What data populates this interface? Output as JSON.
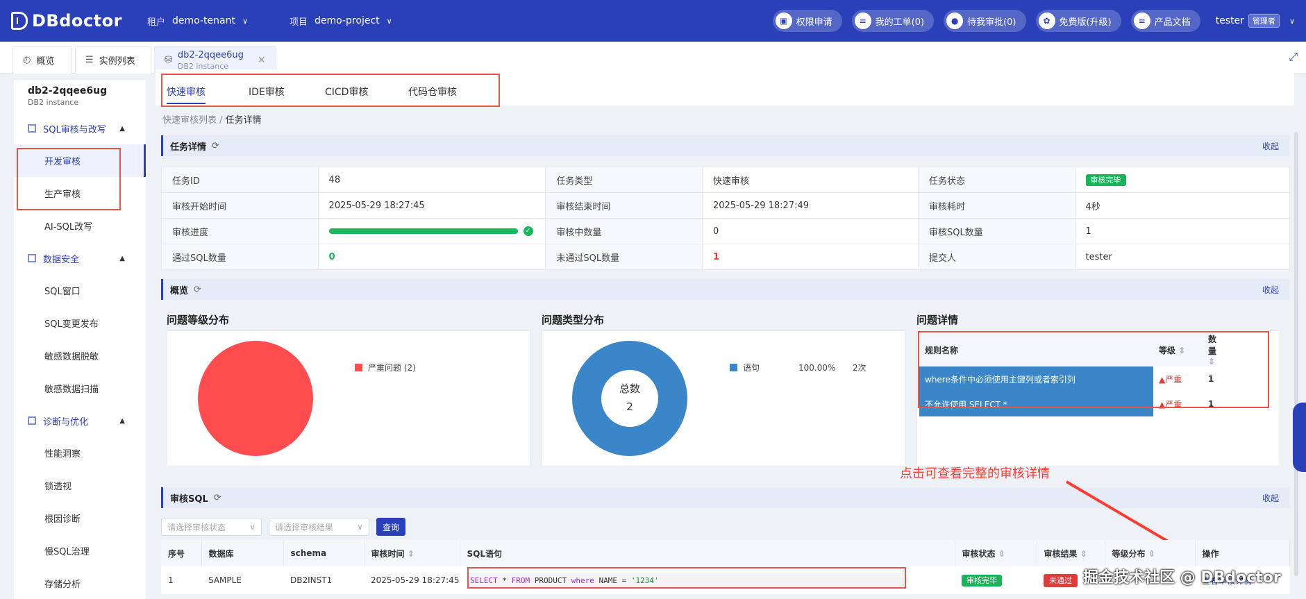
{
  "app": {
    "logo": "DBdoctor",
    "tenant_label": "租户",
    "tenant_value": "demo-tenant",
    "project_label": "项目",
    "project_value": "demo-project",
    "actions": [
      "权限申请",
      "我的工单(0)",
      "待我审批(0)",
      "免费版(升级)",
      "产品文档"
    ],
    "user": "tester",
    "role": "管理者"
  },
  "tabs": {
    "overview": "概览",
    "instances": "实例列表",
    "active_name": "db2-2qqee6ug",
    "active_sub": "DB2 instance"
  },
  "sidebar": {
    "inst_name": "db2-2qqee6ug",
    "inst_type": "DB2 instance",
    "groups": [
      {
        "label": "SQL审核与改写",
        "items": [
          "开发审核",
          "生产审核",
          "AI-SQL改写"
        ]
      },
      {
        "label": "数据安全",
        "items": [
          "SQL窗口",
          "SQL变更发布",
          "敏感数据脱敏",
          "敏感数据扫描"
        ]
      },
      {
        "label": "诊断与优化",
        "items": [
          "性能洞察",
          "锁透视",
          "根因诊断",
          "慢SQL治理",
          "存储分析"
        ]
      }
    ]
  },
  "subtabs": [
    "快速审核",
    "IDE审核",
    "CICD审核",
    "代码仓审核"
  ],
  "breadcrumb": {
    "parent": "快速审核列表",
    "current": "任务详情"
  },
  "sections": {
    "task": "任务详情",
    "overview": "概览",
    "sql": "审核SQL",
    "fold": "收起"
  },
  "task": {
    "id_l": "任务ID",
    "id": "48",
    "type_l": "任务类型",
    "type": "快速审核",
    "status_l": "任务状态",
    "status": "审核完毕",
    "start_l": "审核开始时间",
    "start": "2025-05-29 18:27:45",
    "end_l": "审核结束时间",
    "end": "2025-05-29 18:27:49",
    "cost_l": "审核耗时",
    "cost": "4秒",
    "progress_l": "审核进度",
    "progress": 1.0,
    "auditing_l": "审核中数量",
    "auditing": "0",
    "sqlcount_l": "审核SQL数量",
    "sqlcount": "1",
    "pass_l": "通过SQL数量",
    "pass": "0",
    "fail_l": "未通过SQL数量",
    "fail": "1",
    "submitter_l": "提交人",
    "submitter": "tester"
  },
  "overview": {
    "level_title": "问题等级分布",
    "type_title": "问题类型分布",
    "detail_title": "问题详情",
    "level_legend": "严重问题 (2)",
    "type_legend": "语句",
    "type_pct": "100.00%",
    "type_cnt": "2次",
    "donut_label": "总数",
    "donut_value": "2",
    "cols": {
      "name": "规则名称",
      "level": "等级",
      "count": "数量"
    },
    "issues": [
      {
        "name": "where条件中必须使用主键列或者索引列",
        "level": "严重",
        "count": "1"
      },
      {
        "name": "不允许使用 SELECT *",
        "level": "严重",
        "count": "1"
      }
    ]
  },
  "annotation": "点击可查看完整的审核详情",
  "filters": {
    "status_ph": "请选择审核状态",
    "result_ph": "请选择审核结果",
    "query": "查询"
  },
  "sqltable": {
    "cols": [
      "序号",
      "数据库",
      "schema",
      "审核时间",
      "SQL语句",
      "审核状态",
      "审核结果",
      "等级分布",
      "操作"
    ],
    "row": {
      "no": "1",
      "db": "SAMPLE",
      "schema": "DB2INST1",
      "time": "2025-05-29 18:27:45",
      "status": "审核完毕",
      "result": "未通过",
      "action": "查看审核详情",
      "sql": {
        "k1": "SELECT",
        "t1": " * ",
        "k2": "FROM",
        "t2": " PRODUCT ",
        "k3": "where",
        "t3": " NAME = ",
        "s": "'1234'"
      }
    }
  },
  "watermark": "掘金技术社区 @ DBdoctor",
  "colors": {
    "brand": "#2a40b8",
    "pie": "#ff4d4f",
    "donut": "#3a86c8",
    "green": "#19b35a",
    "red": "#e03b3b"
  }
}
